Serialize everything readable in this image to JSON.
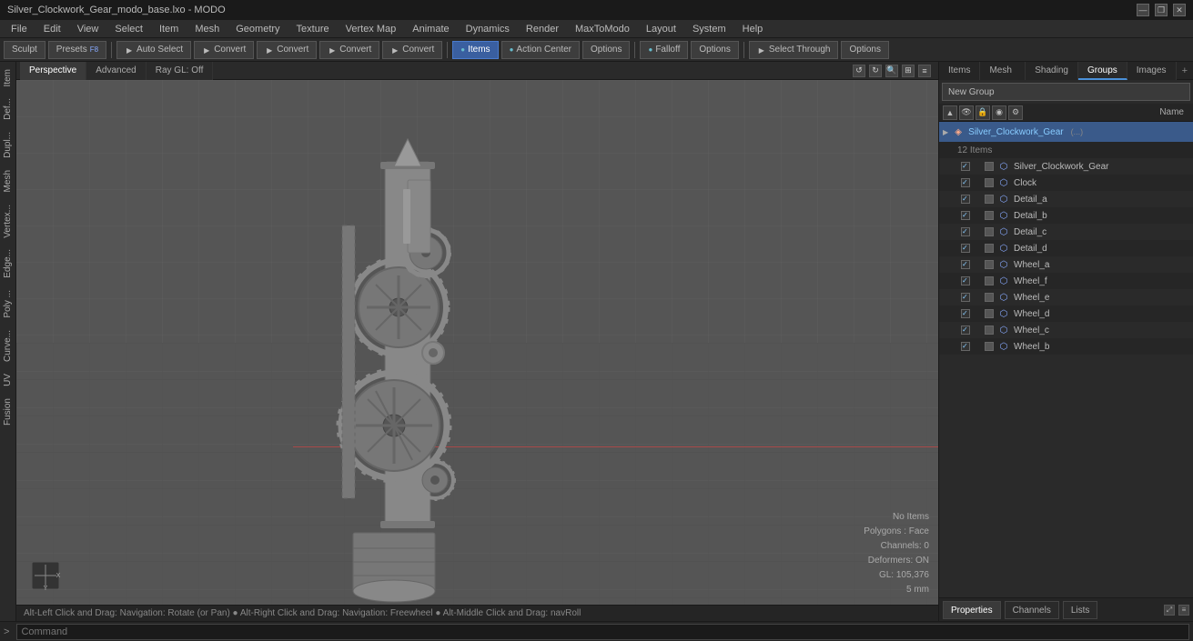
{
  "titlebar": {
    "title": "Silver_Clockwork_Gear_modo_base.lxo - MODO",
    "controls": [
      "—",
      "❐",
      "✕"
    ]
  },
  "menubar": {
    "items": [
      "File",
      "Edit",
      "View",
      "Select",
      "Item",
      "Mesh",
      "Geometry",
      "Texture",
      "Vertex Map",
      "Animate",
      "Dynamics",
      "Render",
      "MaxToModo",
      "Layout",
      "System",
      "Help"
    ]
  },
  "toolbar": {
    "sculpt_label": "Sculpt",
    "presets_label": "Presets",
    "fi_label": "F8",
    "auto_select_label": "Auto Select",
    "convert1_label": "Convert",
    "convert2_label": "Convert",
    "convert3_label": "Convert",
    "convert4_label": "Convert",
    "items_label": "Items",
    "action_center_label": "Action Center",
    "options1_label": "Options",
    "falloff_label": "Falloff",
    "options2_label": "Options",
    "select_through_label": "Select Through",
    "options3_label": "Options"
  },
  "viewport": {
    "tabs": [
      "Perspective",
      "Advanced",
      "Ray GL: Off"
    ],
    "status": {
      "no_items": "No Items",
      "polygons": "Polygons : Face",
      "channels": "Channels: 0",
      "deformers": "Deformers: ON",
      "gl": "GL: 105,376",
      "scale": "5 mm"
    }
  },
  "nav_hint": {
    "text": "Alt-Left Click and Drag: Navigation: Rotate (or Pan) ● Alt-Right Click and Drag: Navigation: Freewheel ● Alt-Middle Click and Drag: navRoll"
  },
  "right_panel": {
    "tabs": [
      "Items",
      "Mesh ...",
      "Shading",
      "Groups",
      "Images"
    ],
    "active_tab": "Groups",
    "new_group_label": "New Group",
    "name_col": "Name",
    "root_item": {
      "label": "Silver_Clockwork_Gear",
      "sub_label": "12 Items"
    },
    "items": [
      {
        "name": "Silver_Clockwork_Gear",
        "type": "mesh",
        "visible": true
      },
      {
        "name": "Clock",
        "type": "mesh",
        "visible": true
      },
      {
        "name": "Detail_a",
        "type": "mesh",
        "visible": true
      },
      {
        "name": "Detail_b",
        "type": "mesh",
        "visible": true
      },
      {
        "name": "Detail_c",
        "type": "mesh",
        "visible": true
      },
      {
        "name": "Detail_d",
        "type": "mesh",
        "visible": true
      },
      {
        "name": "Wheel_a",
        "type": "mesh",
        "visible": true
      },
      {
        "name": "Wheel_f",
        "type": "mesh",
        "visible": true
      },
      {
        "name": "Wheel_e",
        "type": "mesh",
        "visible": true
      },
      {
        "name": "Wheel_d",
        "type": "mesh",
        "visible": true
      },
      {
        "name": "Wheel_c",
        "type": "mesh",
        "visible": true
      },
      {
        "name": "Wheel_b",
        "type": "mesh",
        "visible": true
      }
    ],
    "bottom_tabs": [
      "Properties",
      "Channels",
      "Lists"
    ],
    "active_bottom_tab": "Properties"
  },
  "command_bar": {
    "prompt": ">",
    "placeholder": "Command"
  }
}
